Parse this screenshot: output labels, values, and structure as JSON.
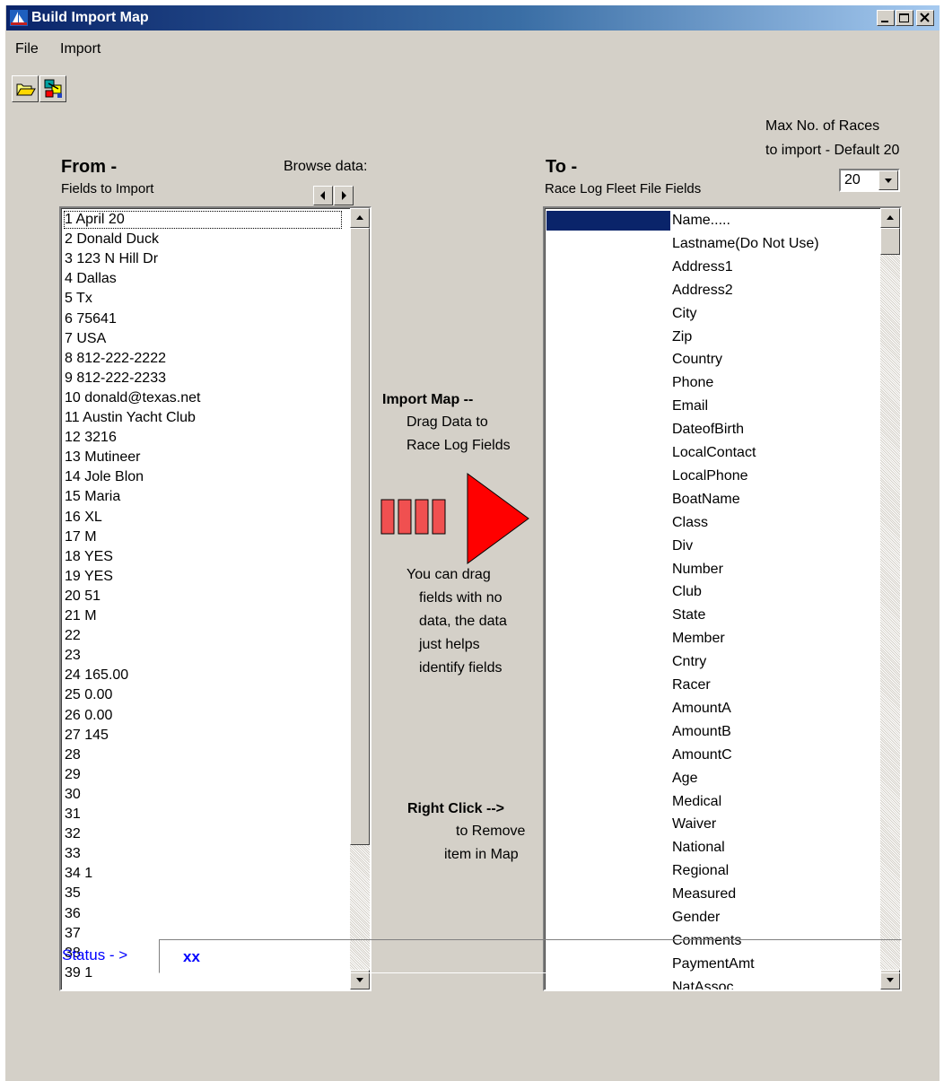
{
  "window": {
    "title": "Build Import Map"
  },
  "menu": [
    "File",
    "Import"
  ],
  "toolbar": {
    "open_icon": "folder-open-icon",
    "map_icon": "import-map-icon"
  },
  "from": {
    "heading": "From -",
    "subheading": "Fields to Import",
    "browse_label": "Browse data:",
    "items": [
      "1  April 20",
      "2  Donald Duck",
      "3  123 N Hill Dr",
      "4  Dallas",
      "5  Tx",
      "6  75641",
      "7  USA",
      "8  812-222-2222",
      "9  812-222-2233",
      "10 donald@texas.net",
      "11 Austin Yacht Club",
      "12 3216",
      "13 Mutineer",
      "14 Jole Blon",
      "15 Maria",
      "16 XL",
      "17 M",
      "18 YES",
      "19 YES",
      "20 51",
      "21 M",
      "22",
      "23",
      "24 165.00",
      "25 0.00",
      "26 0.00",
      "27 145",
      "28",
      "29",
      "30",
      "31",
      "32",
      "33",
      "34 1",
      "35",
      "36",
      "37",
      "38",
      "39 1"
    ]
  },
  "to": {
    "heading": "To -",
    "subheading": "Race Log Fleet File Fields",
    "max_races_label_1": "Max No. of Races",
    "max_races_label_2": "to import - Default 20",
    "max_races_value": "20",
    "items": [
      "Name.....",
      "Lastname(Do Not Use)",
      "Address1",
      "Address2",
      "City",
      "Zip",
      "Country",
      "Phone",
      "Email",
      "DateofBirth",
      "LocalContact",
      "LocalPhone",
      "BoatName",
      "Class",
      "Div",
      "Number",
      "Club",
      "State",
      "Member",
      "Cntry",
      "Racer",
      "AmountA",
      "AmountB",
      "AmountC",
      "Age",
      "Medical",
      "Waiver",
      "National",
      "Regional",
      "Measured",
      "Gender",
      "Comments",
      "PaymentAmt",
      "NatAssoc"
    ]
  },
  "center": {
    "import_map_title": "Import Map --",
    "import_map_lines": [
      "Drag Data to",
      "Race Log Fields"
    ],
    "drag_note_lines": [
      "You can drag",
      "fields with no",
      "data, the data",
      "just helps",
      "identify fields"
    ],
    "right_click_title": "Right Click -->",
    "right_click_lines": [
      "to Remove",
      "item in Map"
    ]
  },
  "status": {
    "label": "Status - >",
    "value": "xx"
  },
  "colors": {
    "selection": "#0a246a",
    "status_text": "#0000ff",
    "arrow": "#ff0000",
    "arrow_block": "#f05050"
  }
}
